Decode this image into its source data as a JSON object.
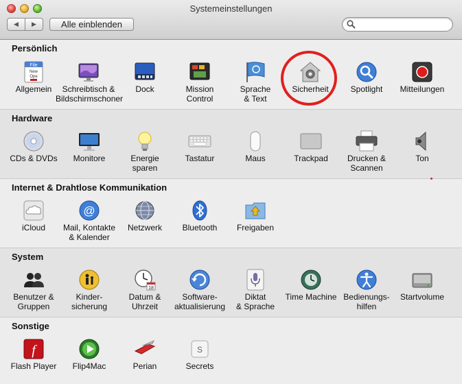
{
  "window": {
    "title": "Systemeinstellungen"
  },
  "toolbar": {
    "show_all": "Alle einblenden",
    "search_placeholder": ""
  },
  "sections": {
    "personal": {
      "title": "Persönlich",
      "items": [
        {
          "line1": "Allgemein",
          "line2": ""
        },
        {
          "line1": "Schreibtisch &",
          "line2": "Bildschirmschoner"
        },
        {
          "line1": "Dock",
          "line2": ""
        },
        {
          "line1": "Mission",
          "line2": "Control"
        },
        {
          "line1": "Sprache",
          "line2": "& Text"
        },
        {
          "line1": "Sicherheit",
          "line2": ""
        },
        {
          "line1": "Spotlight",
          "line2": ""
        },
        {
          "line1": "Mitteilungen",
          "line2": ""
        }
      ]
    },
    "hardware": {
      "title": "Hardware",
      "items": [
        {
          "line1": "CDs & DVDs",
          "line2": ""
        },
        {
          "line1": "Monitore",
          "line2": ""
        },
        {
          "line1": "Energie",
          "line2": "sparen"
        },
        {
          "line1": "Tastatur",
          "line2": ""
        },
        {
          "line1": "Maus",
          "line2": ""
        },
        {
          "line1": "Trackpad",
          "line2": ""
        },
        {
          "line1": "Drucken &",
          "line2": "Scannen"
        },
        {
          "line1": "Ton",
          "line2": ""
        }
      ]
    },
    "internet": {
      "title": "Internet & Drahtlose Kommunikation",
      "items": [
        {
          "line1": "iCloud",
          "line2": ""
        },
        {
          "line1": "Mail, Kontakte",
          "line2": "& Kalender"
        },
        {
          "line1": "Netzwerk",
          "line2": ""
        },
        {
          "line1": "Bluetooth",
          "line2": ""
        },
        {
          "line1": "Freigaben",
          "line2": ""
        }
      ]
    },
    "system": {
      "title": "System",
      "items": [
        {
          "line1": "Benutzer &",
          "line2": "Gruppen"
        },
        {
          "line1": "Kinder-",
          "line2": "sicherung"
        },
        {
          "line1": "Datum &",
          "line2": "Uhrzeit"
        },
        {
          "line1": "Software-",
          "line2": "aktualisierung"
        },
        {
          "line1": "Diktat",
          "line2": "& Sprache"
        },
        {
          "line1": "Time Machine",
          "line2": ""
        },
        {
          "line1": "Bedienungs-",
          "line2": "hilfen"
        },
        {
          "line1": "Startvolume",
          "line2": ""
        }
      ]
    },
    "other": {
      "title": "Sonstige",
      "items": [
        {
          "line1": "Flash Player",
          "line2": ""
        },
        {
          "line1": "Flip4Mac",
          "line2": ""
        },
        {
          "line1": "Perian",
          "line2": ""
        },
        {
          "line1": "Secrets",
          "line2": ""
        }
      ]
    }
  },
  "icons": {
    "calendar_day": "18",
    "icloud_glyph": "@",
    "secrets_glyph": "S",
    "flash_glyph": "f"
  },
  "colors": {
    "highlight_circle": "#e0201e",
    "selection_blue": "#3f7fd8"
  }
}
